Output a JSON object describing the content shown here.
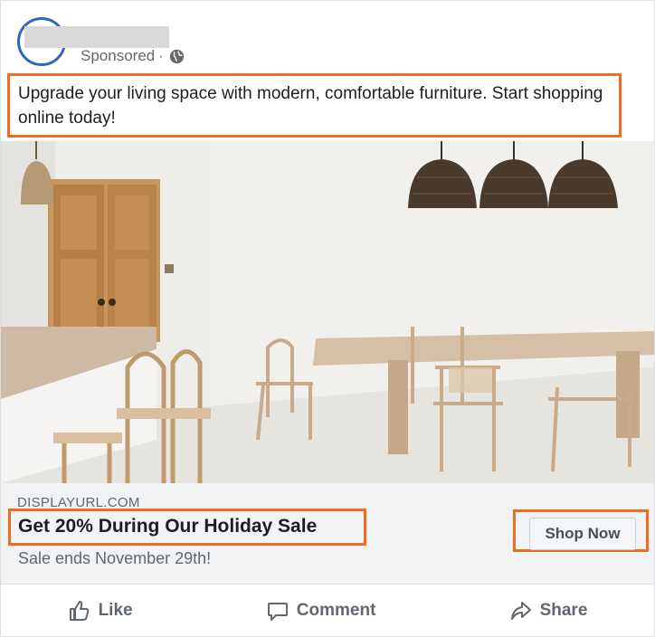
{
  "post": {
    "sponsored_label": "Sponsored",
    "separator": "·",
    "primary_text": "Upgrade your living space with modern, comfortable furniture. Start shopping online today!"
  },
  "link": {
    "display_url": "DISPLAYURL.COM",
    "headline": "Get 20% During Our Holiday Sale",
    "description": "Sale ends November 29th!",
    "cta_label": "Shop Now"
  },
  "actions": {
    "like": "Like",
    "comment": "Comment",
    "share": "Share"
  },
  "icons": {
    "privacy": "globe-icon",
    "like": "thumbs-up-icon",
    "comment": "comment-icon",
    "share": "share-arrow-icon"
  },
  "colors": {
    "highlight": "#f26b21",
    "avatar_ring": "#2d66c3",
    "action_text": "#606770",
    "link_bg": "#f2f3f5"
  }
}
